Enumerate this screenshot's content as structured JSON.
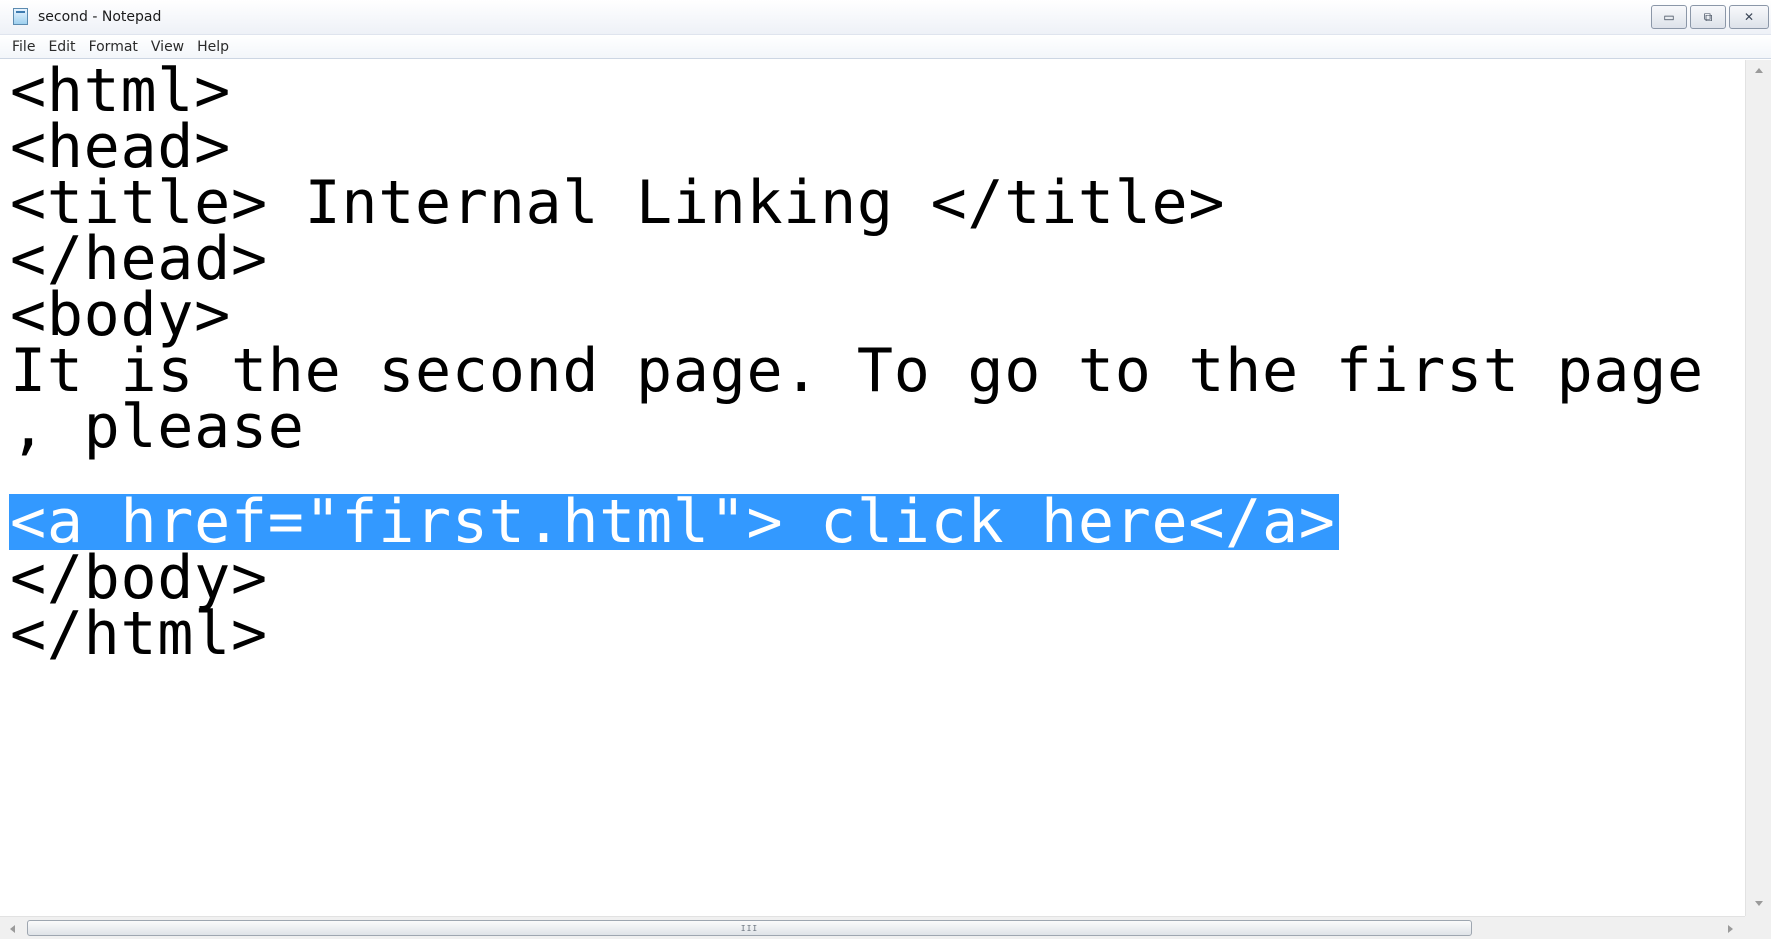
{
  "window": {
    "title": "second - Notepad",
    "controls": {
      "minimize_glyph": "▭",
      "maximize_glyph": "⧉",
      "close_glyph": "✕"
    }
  },
  "menu": {
    "items": [
      "File",
      "Edit",
      "Format",
      "View",
      "Help"
    ]
  },
  "editor": {
    "lines": [
      "<html>",
      "<head>",
      "<title> Internal Linking </title>",
      "</head>",
      "<body>",
      "It is the second page. To go to the first page",
      ", please",
      "<a href=\"first.html\"> click here</a>",
      "</body>",
      "</html>"
    ],
    "selected_line_index": 7,
    "selection_color": "#3399ff"
  },
  "scrollbar": {
    "grip_glyph": "III"
  }
}
